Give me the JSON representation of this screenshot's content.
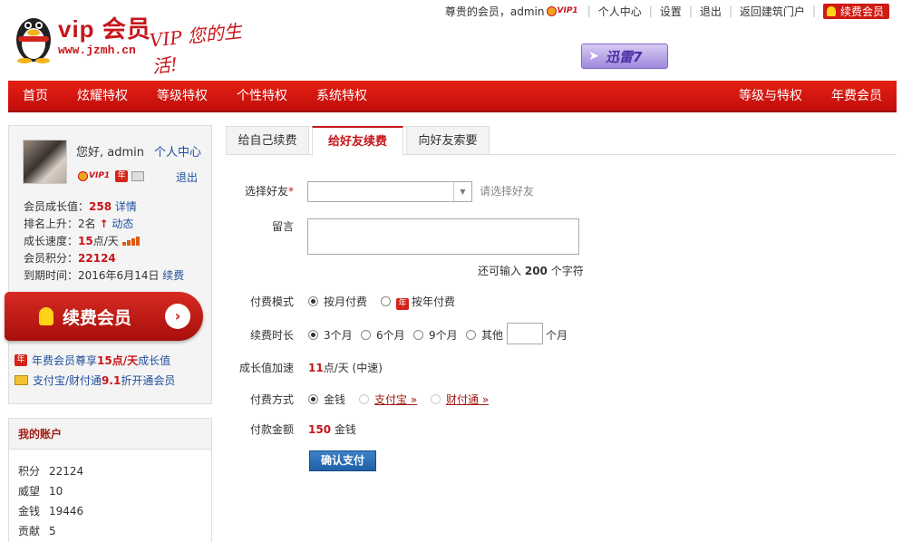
{
  "header": {
    "logo_text": "vip 会员",
    "logo_url": "www.jzmh.cn",
    "logo_slogan": "VIP 您的生活!",
    "greeting": "尊贵的会员，admin",
    "vip_level": "VIP1",
    "links": [
      "个人中心",
      "设置",
      "退出",
      "返回建筑门户"
    ],
    "renew_button": "续费会员",
    "xunlei_label": "迅雷7"
  },
  "nav": {
    "left": [
      "首页",
      "炫耀特权",
      "等级特权",
      "个性特权",
      "系统特权"
    ],
    "right": [
      "等级与特权",
      "年费会员"
    ]
  },
  "profile": {
    "hello": "您好, admin",
    "center_link": "个人中心",
    "vip_level": "VIP1",
    "year_badge": "年",
    "logout": "退出",
    "growth_label": "会员成长值：",
    "growth_value": "258",
    "growth_link": "详情",
    "rank_label": "排名上升：",
    "rank_value": "2名",
    "rank_link": "动态",
    "speed_label": "成长速度：",
    "speed_value": "15",
    "speed_unit": "点/天",
    "points_label": "会员积分：",
    "points_value": "22124",
    "expire_label": "到期时间：",
    "expire_value": "2016年6月14日",
    "expire_link": "续费",
    "renew_big": "续费会员",
    "promo1_pre": "年费会员尊享",
    "promo1_hi": "15点/天",
    "promo1_post": "成长值",
    "promo2_pre": "支付宝/财付通",
    "promo2_hi": "9.1",
    "promo2_post": "折开通会员"
  },
  "account": {
    "title": "我的账户",
    "rows": [
      {
        "k": "积分",
        "v": "22124"
      },
      {
        "k": "威望",
        "v": "10"
      },
      {
        "k": "金钱",
        "v": "19446"
      },
      {
        "k": "贡献",
        "v": "5"
      }
    ]
  },
  "tabs": [
    "给自己续费",
    "给好友续费",
    "向好友索要"
  ],
  "form": {
    "friend_label": "选择好友",
    "friend_required": "*",
    "friend_hint": "请选择好友",
    "message_label": "留言",
    "remain_pre": "还可输入",
    "remain_count": "200",
    "remain_post": "个字符",
    "mode_label": "付费模式",
    "mode_monthly": "按月付费",
    "mode_yearly": "按年付费",
    "year_badge": "年",
    "duration_label": "续费时长",
    "duration_options": [
      "3个月",
      "6个月",
      "9个月",
      "其他"
    ],
    "duration_unit": "个月",
    "growth_label": "成长值加速",
    "growth_value": "11",
    "growth_unit": "点/天 (中速)",
    "paymethod_label": "付费方式",
    "paymethod_options": [
      "金钱",
      "支付宝 »",
      "财付通 »"
    ],
    "amount_label": "付款金额",
    "amount_value": "150",
    "amount_unit": "金钱",
    "submit": "确认支付"
  }
}
